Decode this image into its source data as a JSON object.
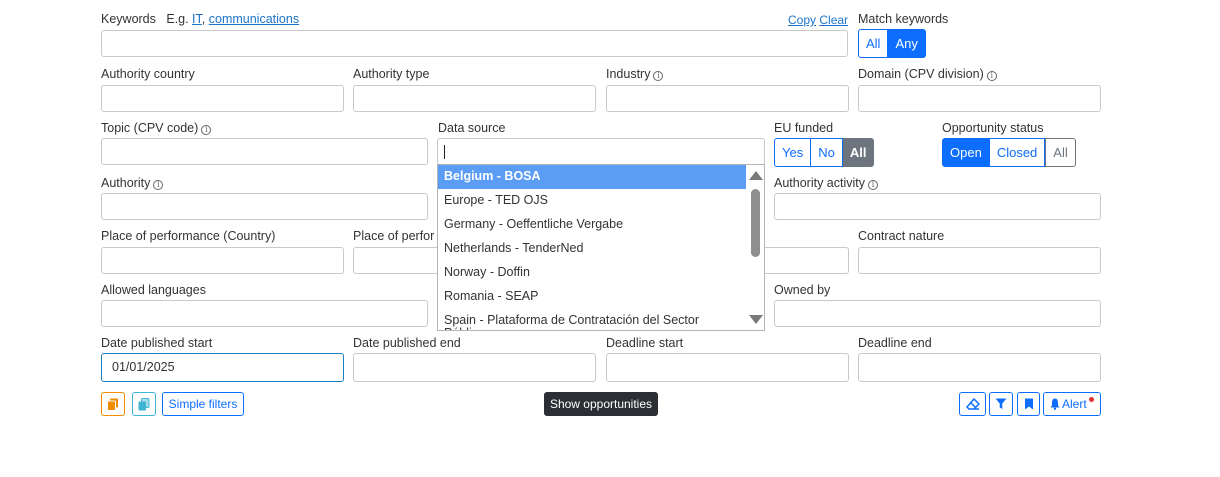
{
  "keywords": {
    "label": "Keywords",
    "example_prefix": "E.g.",
    "example_1": "IT",
    "example_sep": ",",
    "example_2": "communications",
    "copy": "Copy",
    "clear": "Clear",
    "value": ""
  },
  "match_keywords": {
    "label": "Match keywords",
    "options": [
      "All",
      "Any"
    ],
    "selected": "Any"
  },
  "fields": {
    "authority_country": "Authority country",
    "authority_type": "Authority type",
    "industry": "Industry",
    "domain": "Domain (CPV division)",
    "topic": "Topic (CPV code)",
    "data_source": "Data source",
    "authority": "Authority",
    "authority_activity": "Authority activity",
    "place_country": "Place of performance (Country)",
    "place_other": "Place of perfor",
    "contract_nature": "Contract nature",
    "allowed_languages": "Allowed languages",
    "owned_by": "Owned by",
    "date_published_start": "Date published start",
    "date_published_end": "Date published end",
    "deadline_start": "Deadline start",
    "deadline_end": "Deadline end"
  },
  "date_published_start_value": "01/01/2025",
  "eu_funded": {
    "label": "EU funded",
    "options": [
      "Yes",
      "No",
      "All"
    ],
    "selected": "All"
  },
  "opportunity_status": {
    "label": "Opportunity status",
    "options": [
      "Open",
      "Closed",
      "All"
    ],
    "selected": "Open"
  },
  "data_source_options": [
    "Belgium - BOSA",
    "Europe - TED OJS",
    "Germany - Oeffentliche Vergabe",
    "Netherlands - TenderNed",
    "Norway - Doffin",
    "Romania - SEAP",
    "Spain - Plataforma de Contratación del Sector Público"
  ],
  "data_source_highlighted": "Belgium - BOSA",
  "footer": {
    "simple_filters": "Simple filters",
    "show_opportunities": "Show opportunities",
    "alert": "Alert"
  },
  "colors": {
    "primary": "#0d6efd",
    "secondary": "#6c757d",
    "orange": "#f08c00",
    "teal": "#3fb6d6",
    "alert_dot": "#e03131"
  },
  "icons": [
    "copy-icon",
    "files-icon",
    "eraser-icon",
    "filter-icon",
    "bookmark-icon",
    "bell-icon",
    "info-icon",
    "scroll-up-icon",
    "scroll-down-icon"
  ]
}
